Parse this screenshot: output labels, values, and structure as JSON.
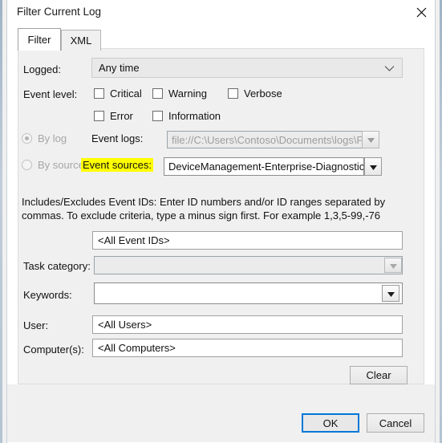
{
  "window": {
    "title": "Filter Current Log",
    "close_icon": "close-icon"
  },
  "tabs": [
    {
      "label": "Filter",
      "selected": true
    },
    {
      "label": "XML",
      "selected": false
    }
  ],
  "form": {
    "logged": {
      "label": "Logged:",
      "value": "Any time",
      "chevron_icon": "chevron-down-icon"
    },
    "event_level": {
      "label": "Event level:",
      "options": [
        {
          "label": "Critical",
          "checked": false
        },
        {
          "label": "Warning",
          "checked": false
        },
        {
          "label": "Verbose",
          "checked": false
        },
        {
          "label": "Error",
          "checked": false
        },
        {
          "label": "Information",
          "checked": false
        }
      ]
    },
    "source_mode": {
      "by_log": {
        "label": "By log",
        "selected": true,
        "disabled": true
      },
      "by_source": {
        "label": "By source",
        "selected": false,
        "disabled": true
      }
    },
    "event_logs": {
      "label": "Event logs:",
      "value": "file://C:\\Users\\Contoso\\Documents\\logs\\FieldMedi",
      "disabled": true,
      "dropdown_icon": "triangle-down-icon"
    },
    "event_sources": {
      "label": "Event sources:",
      "highlighted": true,
      "highlight_color": "#FFFF00",
      "value": "DeviceManagement-Enterprise-Diagnostics-Pr",
      "dropdown_icon": "triangle-down-icon"
    },
    "event_ids": {
      "hint": "Includes/Excludes Event IDs: Enter ID numbers and/or ID ranges separated by commas. To exclude criteria, type a minus sign first. For example 1,3,5-99,-76",
      "value": "<All Event IDs>"
    },
    "task_category": {
      "label": "Task category:",
      "value": "",
      "disabled": true,
      "dropdown_icon": "triangle-down-icon"
    },
    "keywords": {
      "label": "Keywords:",
      "value": "",
      "disabled": false,
      "dropdown_icon": "triangle-down-icon"
    },
    "user": {
      "label": "User:",
      "value": "<All Users>"
    },
    "computers": {
      "label": "Computer(s):",
      "value": "<All Computers>"
    },
    "clear_button": "Clear"
  },
  "footer": {
    "ok": "OK",
    "cancel": "Cancel",
    "accent_color": "#0078D7"
  }
}
